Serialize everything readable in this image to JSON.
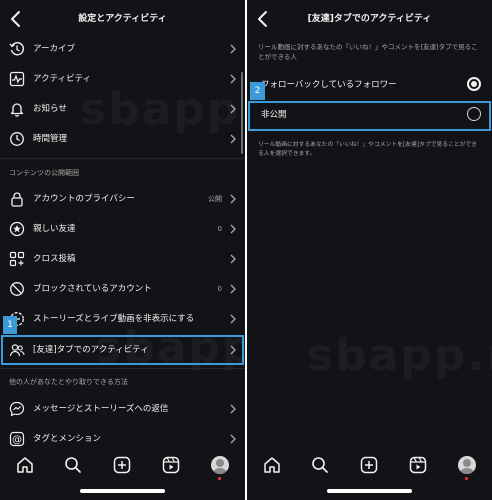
{
  "left": {
    "title": "設定とアクティビティ",
    "items_top": [
      {
        "label": "アーカイブ",
        "icon": "archive-icon"
      },
      {
        "label": "アクティビティ",
        "icon": "activity-icon"
      },
      {
        "label": "お知らせ",
        "icon": "bell-icon"
      },
      {
        "label": "時間管理",
        "icon": "clock-icon"
      }
    ],
    "section1": "コンテンツの公開範囲",
    "items_mid": [
      {
        "label": "アカウントのプライバシー",
        "value": "公開",
        "icon": "lock-icon"
      },
      {
        "label": "親しい友達",
        "value": "0",
        "icon": "star-icon"
      },
      {
        "label": "クロス投稿",
        "value": "",
        "icon": "cross-post-icon"
      },
      {
        "label": "ブロックされているアカウント",
        "value": "0",
        "icon": "block-icon"
      },
      {
        "label": "ストーリーズとライブ動画を非表示にする",
        "value": "",
        "icon": "hide-story-icon"
      },
      {
        "label": "[友達]タブでのアクティビティ",
        "value": "",
        "icon": "friends-icon"
      }
    ],
    "section2": "他の人があなたとやり取りできる方法",
    "items_bottom": [
      {
        "label": "メッセージとストーリーズへの返信",
        "icon": "messenger-icon"
      },
      {
        "label": "タグとメンション",
        "icon": "at-icon"
      }
    ],
    "badge": "1",
    "watermark_top": "sbapp",
    "watermark_bottom": "sbapp.net"
  },
  "right": {
    "title": "[友達]タブでのアクティビティ",
    "description": "リール動画に対するあなたの「いいね！」やコメントを[友達]タブで見ることができる人",
    "options": [
      {
        "label": "フォローバックしているフォロワー",
        "selected": true
      },
      {
        "label": "非公開",
        "selected": false
      }
    ],
    "footnote": "リール動画に対するあなたの「いいね！」やコメントを[友達]タブで見ることができる人を選択できます。",
    "badge": "2",
    "watermark": "sbapp.net"
  },
  "tabbar": [
    "home-icon",
    "search-icon",
    "create-icon",
    "reels-icon",
    "profile-avatar"
  ],
  "colors": {
    "background": "#121316",
    "highlight": "#3d9ad8",
    "notification": "#ff3040"
  }
}
